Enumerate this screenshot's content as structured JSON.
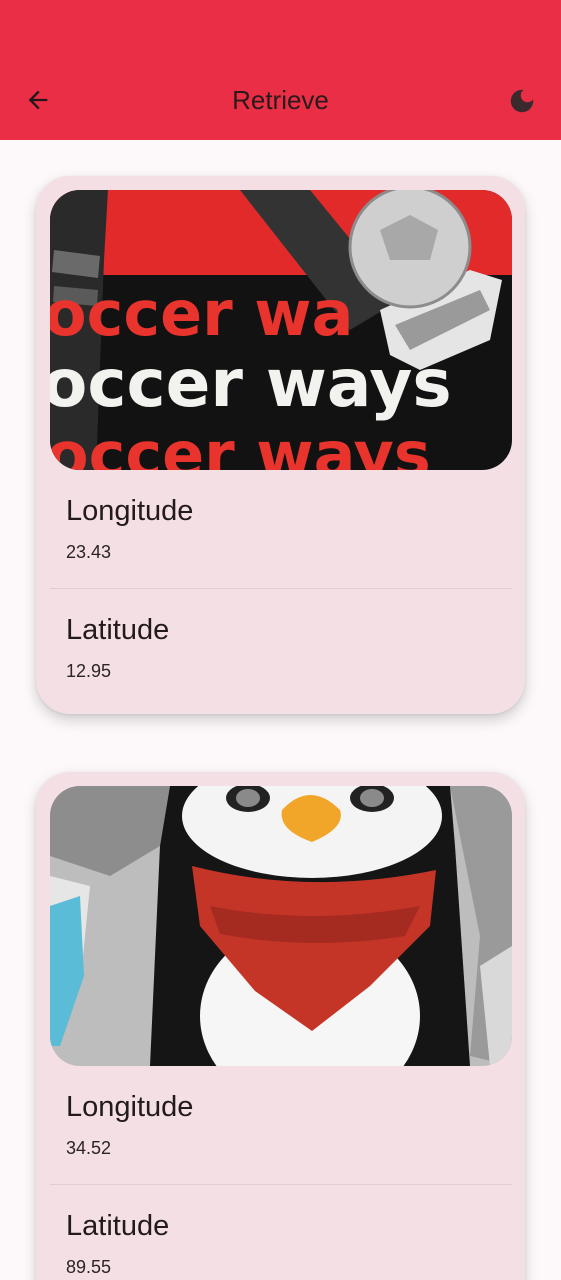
{
  "app_bar": {
    "title": "Retrieve",
    "back_icon": "arrow-back-icon",
    "theme_icon": "dark-mode-moon-icon",
    "background_color": "#ea2e45"
  },
  "records": [
    {
      "image_alt": "soccer ways poster with football",
      "image_text_lines": [
        "occer wa",
        "occer ways",
        "occer ways"
      ],
      "longitude_label": "Longitude",
      "longitude_value": "23.43",
      "latitude_label": "Latitude",
      "latitude_value": "12.95"
    },
    {
      "image_alt": "penguin with red scarf mural",
      "longitude_label": "Longitude",
      "longitude_value": "34.52",
      "latitude_label": "Latitude",
      "latitude_value": "89.55"
    }
  ]
}
